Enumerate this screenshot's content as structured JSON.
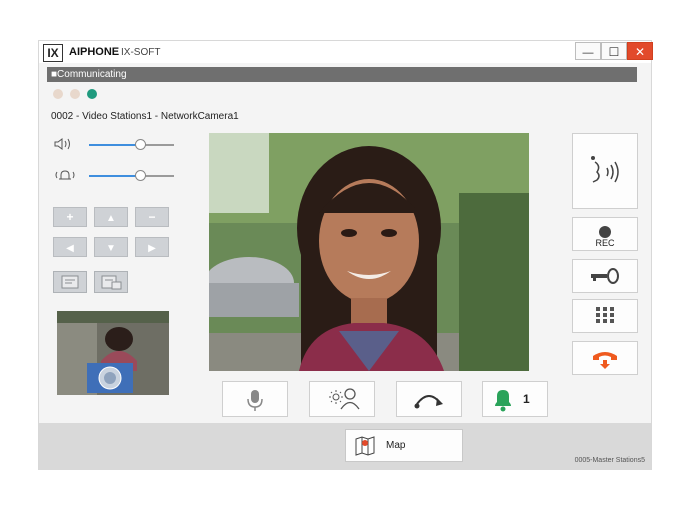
{
  "titlebar": {
    "logo": "IX",
    "brand": "AIPHONE",
    "product": "IX-SOFT",
    "minimize": "—",
    "maximize": "☐",
    "close": "✕"
  },
  "status": {
    "text": "■Communicating"
  },
  "call": {
    "station_label": "0002 - Video Stations1 - NetworkCamera1"
  },
  "volume": {
    "speaker_level": 0.6,
    "mic_level": 0.6
  },
  "ptz": {
    "zoom_in": "+",
    "up": "▲",
    "zoom_out": "−",
    "left": "◀",
    "down": "▼",
    "right": "▶"
  },
  "controls": {
    "notify_count": "1",
    "rec_label": "REC",
    "map_label": "Map"
  },
  "footer": {
    "station_text": "0005-Master Stations5"
  },
  "colors": {
    "close_red": "#e24a2b",
    "accent_blue": "#3e8ede",
    "bell_green": "#2aa35a",
    "hangup_orange": "#ef5a1f",
    "dot_active": "#1f9a7e"
  },
  "icons": {
    "speaker": "speaker-icon",
    "mic_volume": "mic-volume-icon",
    "talk": "talk-icon",
    "record": "record-icon",
    "door_release": "key-icon",
    "keypad": "keypad-icon",
    "hangup": "hangup-icon",
    "mute": "microphone-icon",
    "brightness": "brightness-person-icon",
    "transfer": "transfer-icon",
    "bell": "bell-icon",
    "map": "map-icon"
  }
}
